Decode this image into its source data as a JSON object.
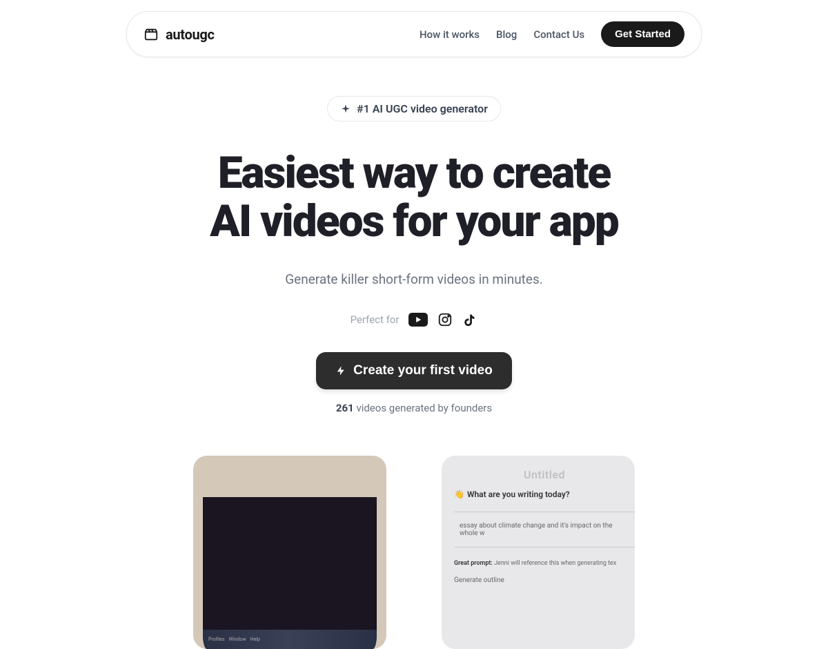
{
  "nav": {
    "brand": "autougc",
    "links": [
      {
        "label": "How it works"
      },
      {
        "label": "Blog"
      },
      {
        "label": "Contact Us"
      }
    ],
    "cta": "Get Started"
  },
  "hero": {
    "badge": "#1 AI UGC video generator",
    "headline_line1": "Easiest way to create",
    "headline_line2": "AI videos for your app",
    "subtitle": "Generate killer short-form videos in minutes.",
    "perfect_for": "Perfect for",
    "cta": "Create your first video",
    "stats_number": "261",
    "stats_text": " videos generated by founders"
  },
  "previews": {
    "card2": {
      "title": "Untitled",
      "prompt": "What are you writing today?",
      "input_text": "essay about climate change and it's impact on the whole w",
      "hint_label": "Great prompt: ",
      "hint_text": "Jenni will reference this when generating tex",
      "generate": "Generate outline"
    }
  }
}
